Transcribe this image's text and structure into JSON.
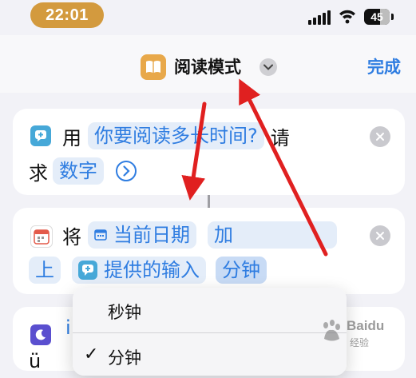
{
  "status_bar": {
    "time": "22:01",
    "battery": "45"
  },
  "nav": {
    "title": "阅读模式",
    "done_label": "完成"
  },
  "card1": {
    "prefix": "用",
    "question_chip": "你要阅读多长时间?",
    "suffix": "请",
    "line2_prefix": "求",
    "type_chip": "数字"
  },
  "card2": {
    "prefix": "将",
    "date_chip": "当前日期",
    "op_chip": "加",
    "line2_prefix": "上",
    "input_chip": "提供的输入",
    "unit_chip": "分钟"
  },
  "card3": {
    "peek_line1": "i",
    "peek_line2": "ü"
  },
  "menu": {
    "items": [
      {
        "label": "秒钟",
        "checked": false
      },
      {
        "label": "分钟",
        "checked": true
      }
    ]
  },
  "watermark": {
    "brand": "Baidu",
    "sub": "经验"
  },
  "colors": {
    "accent": "#2f7de1",
    "time_pill": "#d39a3e",
    "annotation": "#e02020"
  },
  "icons": {
    "app": "book-icon",
    "chevron": "chevron-down-icon",
    "ask": "speech-bubble-icon",
    "calendar": "calendar-icon",
    "moon": "moon-icon",
    "clear": "close-icon",
    "disclose": "chevron-right-circle-icon"
  }
}
